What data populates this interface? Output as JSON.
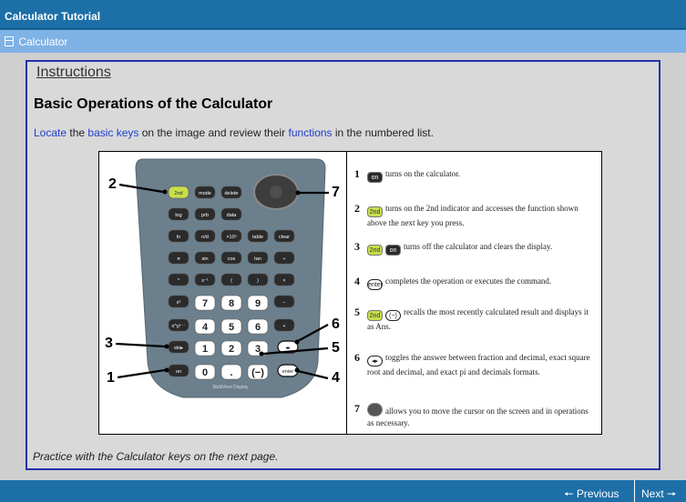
{
  "window": {
    "title": "Calculator Tutorial"
  },
  "section": {
    "label": "Calculator",
    "icon": "collapse-box-icon"
  },
  "content": {
    "instructions_label": "Instructions",
    "heading": "Basic Operations of the Calculator",
    "intro": {
      "link1": "Locate",
      "t1": " the ",
      "link2": "basic keys",
      "t2": " on the image and review their ",
      "link3": "functions",
      "t3": " in the numbered list."
    },
    "practice": "Practice with the Calculator keys on the next page."
  },
  "calculator": {
    "caption": "MultiView Display",
    "callouts": [
      "2",
      "7",
      "3",
      "1",
      "6",
      "5",
      "4"
    ],
    "keys": {
      "row1": [
        "2nd",
        "mode",
        "delete"
      ],
      "row2": [
        "log",
        "prb",
        "data"
      ],
      "row3": [
        "ln",
        "n/d",
        "×10ⁿ",
        "table",
        "clear"
      ],
      "row4": [
        "π",
        "sin",
        "cos",
        "tan",
        "÷"
      ],
      "row5": [
        "^",
        "x⁻¹",
        "(",
        ")",
        "×"
      ],
      "row6": [
        "x²",
        "7",
        "8",
        "9",
        "−"
      ],
      "row7": [
        "x^y/⋯",
        "4",
        "5",
        "6",
        "+"
      ],
      "row8": [
        "sto▸",
        "1",
        "2",
        "3",
        "◂▸"
      ],
      "row9": [
        "on",
        "0",
        ".",
        "(−)",
        "enter"
      ]
    }
  },
  "list": [
    {
      "num": "1",
      "keys": [
        "on"
      ],
      "text": "turns on the calculator."
    },
    {
      "num": "2",
      "keys": [
        "2nd"
      ],
      "text": "turns on the 2nd indicator and accesses the function shown above the next key you press."
    },
    {
      "num": "3",
      "keys": [
        "2nd",
        "on"
      ],
      "text": "turns off the calculator and clears the display."
    },
    {
      "num": "4",
      "keys": [
        "enter"
      ],
      "text": "completes the operation or executes the command."
    },
    {
      "num": "5",
      "keys": [
        "2nd",
        "(−)"
      ],
      "text": "recalls the most recently calculated result and displays it as Ans."
    },
    {
      "num": "6",
      "keys": [
        "◂▸"
      ],
      "text": "toggles the answer between fraction and decimal, exact square root and decimal, and exact pi and decimals formats."
    },
    {
      "num": "7",
      "keys": [],
      "text": "allows you to move the cursor on the screen and in operations as necessary."
    }
  ],
  "key_tops": {
    "off": "off",
    "ans": "ans"
  },
  "footer": {
    "previous": "Previous",
    "next": "Next",
    "previous_icon": "arrow-left-icon",
    "next_icon": "arrow-right-icon"
  }
}
